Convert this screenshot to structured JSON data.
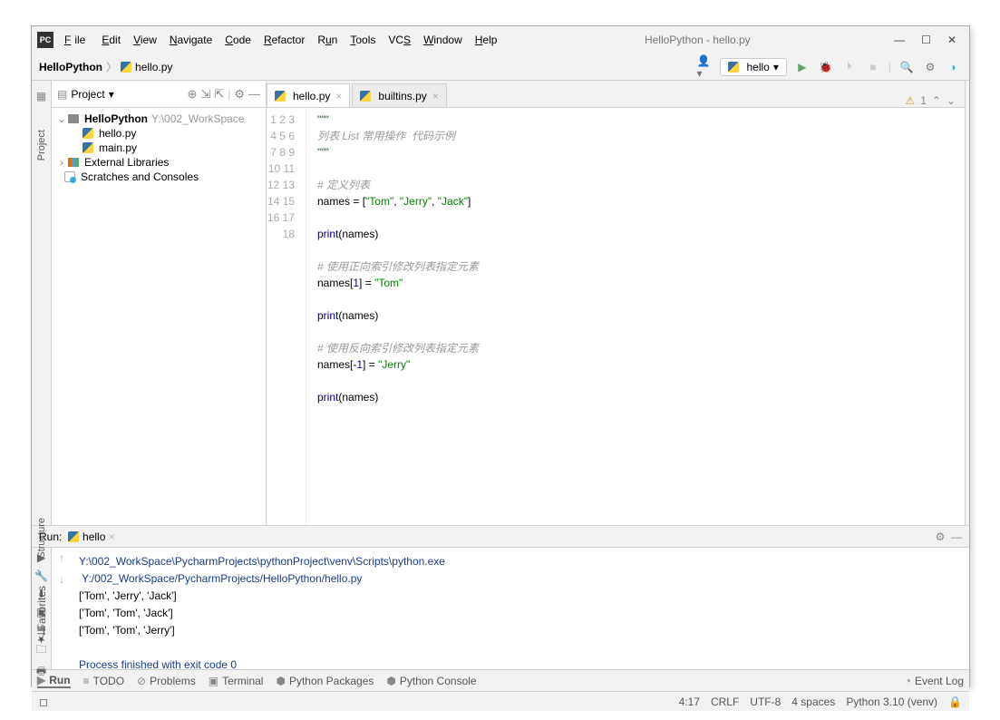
{
  "menu": {
    "file": "File",
    "edit": "Edit",
    "view": "View",
    "navigate": "Navigate",
    "code": "Code",
    "refactor": "Refactor",
    "run": "Run",
    "tools": "Tools",
    "vcs": "VCS",
    "window": "Window",
    "help": "Help"
  },
  "window_title": "HelloPython - hello.py",
  "breadcrumb": {
    "project": "HelloPython",
    "file": "hello.py"
  },
  "run_config": "hello",
  "left_tabs": {
    "project": "Project",
    "structure": "Structure",
    "favorites": "Favorites"
  },
  "project_panel": {
    "title": "Project"
  },
  "tree": {
    "root": "HelloPython",
    "root_path": "Y:\\002_WorkSpace",
    "files": [
      "hello.py",
      "main.py"
    ],
    "ext": "External Libraries",
    "scratch": "Scratches and Consoles"
  },
  "tabs": [
    {
      "name": "hello.py",
      "active": true
    },
    {
      "name": "builtins.py",
      "active": false
    }
  ],
  "warnings": "1",
  "code_lines": [
    {
      "n": 1,
      "html": "<span class='str'>\"\"\"</span>"
    },
    {
      "n": 2,
      "html": "<span class='cm'>列表 List 常用操作  代码示例</span>"
    },
    {
      "n": 3,
      "html": "<span class='str'>\"\"\"</span>"
    },
    {
      "n": 4,
      "html": ""
    },
    {
      "n": 5,
      "html": "<span class='cm'># 定义列表</span>"
    },
    {
      "n": 6,
      "html": "names = [<span class='str'>\"Tom\"</span>, <span class='str'>\"Jerry\"</span>, <span class='str'>\"Jack\"</span>]"
    },
    {
      "n": 7,
      "html": ""
    },
    {
      "n": 8,
      "html": "<span class='fn'>print</span>(names)"
    },
    {
      "n": 9,
      "html": ""
    },
    {
      "n": 10,
      "html": "<span class='cm'># 使用正向索引修改列表指定元素</span>"
    },
    {
      "n": 11,
      "html": "names[<span class='kw'>1</span>] = <span class='str'>\"Tom\"</span>"
    },
    {
      "n": 12,
      "html": "",
      "cur": true
    },
    {
      "n": 13,
      "html": "<span class='fn'>print</span>(names)"
    },
    {
      "n": 14,
      "html": ""
    },
    {
      "n": 15,
      "html": "<span class='cm'># 使用反向索引修改列表指定元素</span>"
    },
    {
      "n": 16,
      "html": "names[-<span class='kw'>1</span>] = <span class='str'>\"Jerry\"</span>"
    },
    {
      "n": 17,
      "html": ""
    },
    {
      "n": 18,
      "html": "<span class='fn'>print</span>(names)"
    }
  ],
  "run": {
    "label": "Run:",
    "tab": "hello",
    "lines": [
      {
        "cls": "path",
        "t": "Y:\\002_WorkSpace\\PycharmProjects\\pythonProject\\venv\\Scripts\\python.exe "
      },
      {
        "cls": "path",
        "t": " Y:/002_WorkSpace/PycharmProjects/HelloPython/hello.py"
      },
      {
        "cls": "",
        "t": "['Tom', 'Jerry', 'Jack']"
      },
      {
        "cls": "",
        "t": "['Tom', 'Tom', 'Jack']"
      },
      {
        "cls": "",
        "t": "['Tom', 'Tom', 'Jerry']"
      },
      {
        "cls": "",
        "t": ""
      },
      {
        "cls": "ok",
        "t": "Process finished with exit code 0"
      }
    ]
  },
  "bottom": {
    "run": "Run",
    "todo": "TODO",
    "problems": "Problems",
    "terminal": "Terminal",
    "pypkg": "Python Packages",
    "pyconsole": "Python Console",
    "eventlog": "Event Log"
  },
  "status": {
    "pos": "4:17",
    "le": "CRLF",
    "enc": "UTF-8",
    "indent": "4 spaces",
    "sdk": "Python 3.10 (venv)"
  }
}
